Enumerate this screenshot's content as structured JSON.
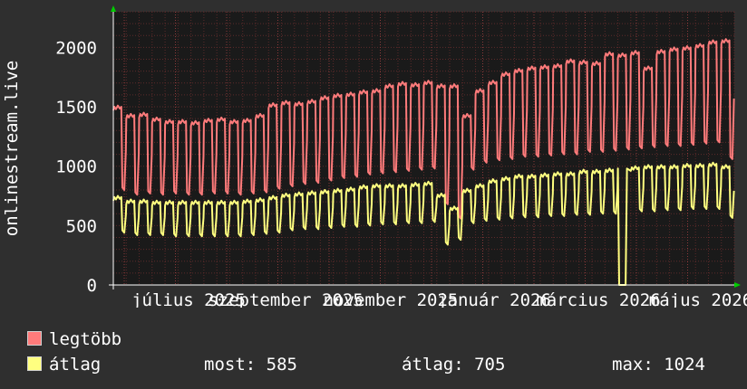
{
  "chart_data": {
    "type": "line",
    "ylabel": "onlinestream.live",
    "ylim": [
      0,
      2300
    ],
    "yticks": [
      0,
      500,
      1000,
      1500,
      2000
    ],
    "grid": true,
    "x_ticks": [
      "július 2025",
      "szeptember 2025",
      "november 2025",
      "január 2026",
      "március 2026",
      "május 2026"
    ],
    "colors": {
      "background": "#2f2f2f",
      "plot_background": "#1a1a1a",
      "grid": "#5c2a2a",
      "axis": "#ffffff",
      "arrow": "#00cc00",
      "legtobb": "#ff7b7b",
      "atlag": "#ffff80"
    },
    "series": [
      {
        "name": "legtöbb",
        "weekday_high": [
          1500,
          1430,
          1440,
          1400,
          1380,
          1380,
          1370,
          1390,
          1400,
          1380,
          1390,
          1430,
          1520,
          1540,
          1530,
          1550,
          1580,
          1600,
          1610,
          1630,
          1640,
          1680,
          1700,
          1690,
          1710,
          1680,
          1680,
          1430,
          1640,
          1710,
          1780,
          1810,
          1830,
          1840,
          1850,
          1890,
          1880,
          1870,
          1950,
          1940,
          1960,
          1830,
          1970,
          1990,
          2000,
          2020,
          2050,
          2060
        ],
        "weekend_low": [
          820,
          780,
          790,
          780,
          790,
          780,
          780,
          790,
          790,
          780,
          790,
          800,
          830,
          850,
          870,
          880,
          900,
          920,
          930,
          950,
          960,
          970,
          980,
          990,
          1000,
          700,
          580,
          990,
          1050,
          1070,
          1080,
          1100,
          1100,
          1110,
          1120,
          1120,
          1140,
          1140,
          1150,
          1160,
          1170,
          1180,
          1190,
          1190,
          1200,
          1210,
          1220,
          1080
        ]
      },
      {
        "name": "átlag",
        "weekday_high": [
          740,
          710,
          710,
          700,
          700,
          700,
          700,
          700,
          700,
          700,
          710,
          720,
          740,
          760,
          770,
          780,
          790,
          800,
          810,
          830,
          840,
          840,
          840,
          850,
          860,
          760,
          650,
          800,
          840,
          880,
          900,
          920,
          920,
          930,
          940,
          940,
          960,
          960,
          970,
          980,
          990,
          1000,
          1000,
          1000,
          1010,
          1010,
          1020,
          1000
        ],
        "weekend_low": [
          460,
          440,
          440,
          440,
          430,
          430,
          430,
          430,
          430,
          430,
          440,
          450,
          460,
          480,
          490,
          490,
          500,
          510,
          510,
          520,
          530,
          530,
          540,
          540,
          550,
          360,
          400,
          540,
          560,
          570,
          580,
          590,
          590,
          600,
          600,
          610,
          610,
          620,
          620,
          630,
          640,
          640,
          650,
          650,
          660,
          660,
          660,
          585
        ],
        "dip": {
          "week": 39,
          "value": 0
        }
      }
    ]
  },
  "legend": {
    "item1": "legtöbb",
    "item2": "átlag",
    "stats": {
      "most": "most: 585",
      "atlag": "átlag: 705",
      "max": "max: 1024"
    }
  }
}
